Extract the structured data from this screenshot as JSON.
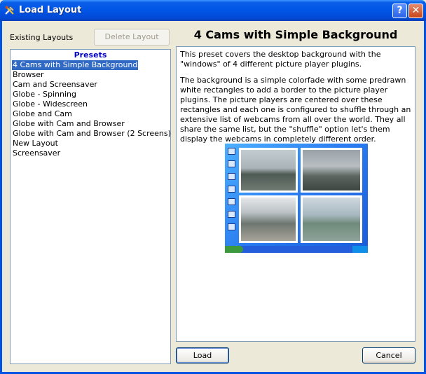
{
  "window": {
    "title": "Load Layout",
    "help": "?",
    "close": "✕"
  },
  "left": {
    "existing_label": "Existing Layouts",
    "delete_label": "Delete Layout",
    "list_header": "Presets",
    "items": [
      "4 Cams with Simple Background",
      "Browser",
      "Cam and Screensaver",
      "Globe - Spinning",
      "Globe - Widescreen",
      "Globe and Cam",
      "Globe with Cam and Browser",
      "Globe with Cam and Browser (2 Screens)",
      "New Layout",
      "Screensaver"
    ],
    "selected_index": 0
  },
  "right": {
    "title": "4 Cams with Simple Background",
    "paragraphs": [
      "This preset covers the desktop background with the \"windows\" of 4 different picture player plugins.",
      "The background is a simple colorfade with some predrawn white rectangles to add a border to the picture player plugins. The picture players are centered over these rectangles and each one is configured to shuffle through an extensive list of webcams from all over the world. They all share the same list, but the \"shuffle\" option let's them display the webcams in completely different order."
    ]
  },
  "buttons": {
    "load": "Load",
    "cancel": "Cancel"
  },
  "colors": {
    "selection": "#316ac5",
    "list_header": "#0000c0",
    "titlebar": "#0055e5"
  }
}
